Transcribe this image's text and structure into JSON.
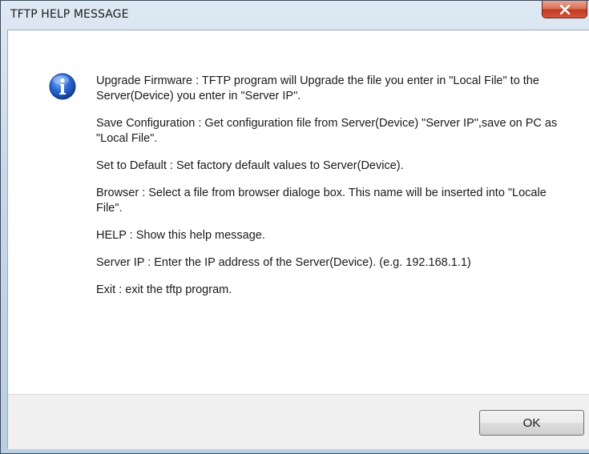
{
  "window": {
    "title": "TFTP HELP MESSAGE",
    "close_icon": "close-icon",
    "accent_close": "#c8402a"
  },
  "dialog": {
    "icon": "info-icon",
    "icon_color": "#1f5fc8",
    "messages": [
      "Upgrade Firmware : TFTP program will Upgrade the file you enter in \"Local File\" to the Server(Device) you enter in \"Server IP\".",
      "Save Configuration : Get configuration file from Server(Device) \"Server IP\",save on PC as \"Local File\".",
      "Set to Default : Set factory default values to Server(Device).",
      "Browser : Select a file from browser dialoge box. This name will be inserted into \"Locale File\".",
      "HELP : Show this help message.",
      "Server IP : Enter the IP address of the Server(Device). (e.g. 192.168.1.1)",
      "Exit : exit the tftp program."
    ]
  },
  "buttons": {
    "ok_label": "OK"
  }
}
